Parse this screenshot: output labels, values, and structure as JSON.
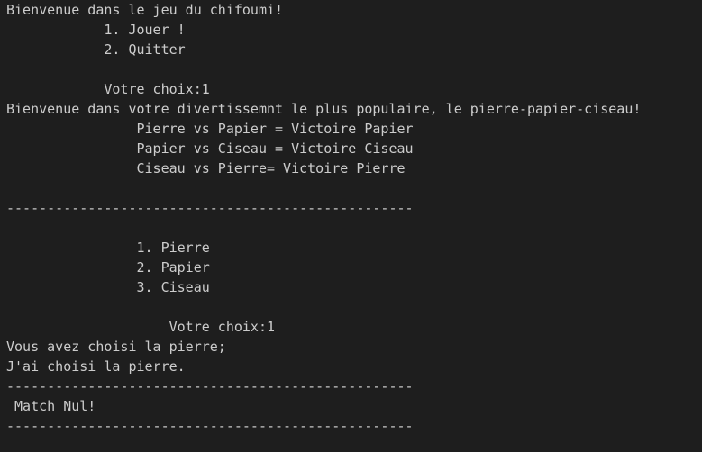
{
  "terminal": {
    "lines": [
      "Bienvenue dans le jeu du chifoumi!",
      "            1. Jouer !",
      "            2. Quitter",
      "",
      "            Votre choix:1",
      "Bienvenue dans votre divertissemnt le plus populaire, le pierre-papier-ciseau!",
      "                Pierre vs Papier = Victoire Papier",
      "                Papier vs Ciseau = Victoire Ciseau",
      "                Ciseau vs Pierre= Victoire Pierre",
      "",
      "--------------------------------------------------",
      "",
      "                1. Pierre",
      "                2. Papier",
      "                3. Ciseau",
      "",
      "                    Votre choix:1",
      "Vous avez choisi la pierre;",
      "J'ai choisi la pierre.",
      "--------------------------------------------------",
      " Match Nul!",
      "--------------------------------------------------"
    ]
  }
}
